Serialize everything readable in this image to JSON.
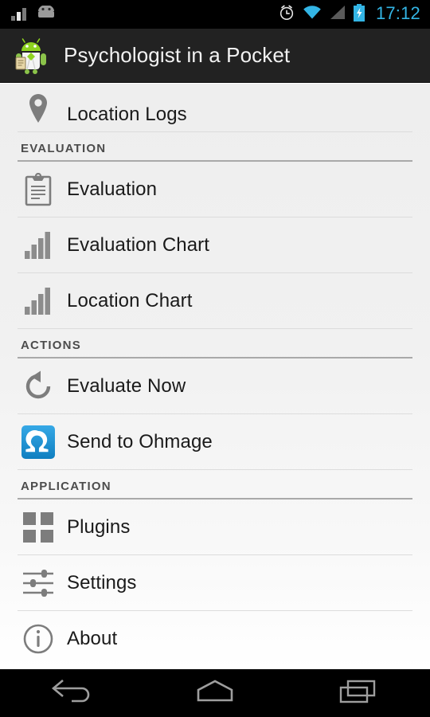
{
  "statusbar": {
    "time": "17:12",
    "icons": [
      "signal-bars-icon",
      "android-head-icon",
      "alarm-clock-icon",
      "wifi-icon",
      "cell-signal-icon",
      "battery-charging-icon"
    ]
  },
  "actionbar": {
    "title": "Psychologist in a Pocket",
    "app_icon": "android-doctor-icon"
  },
  "list": [
    {
      "kind": "item",
      "name": "location-logs",
      "label": "Location Logs",
      "icon": "map-pin-icon"
    },
    {
      "kind": "section",
      "name": "evaluation",
      "label": "EVALUATION"
    },
    {
      "kind": "item",
      "name": "evaluation",
      "label": "Evaluation",
      "icon": "clipboard-icon"
    },
    {
      "kind": "item",
      "name": "evaluation-chart",
      "label": "Evaluation Chart",
      "icon": "bar-chart-icon"
    },
    {
      "kind": "item",
      "name": "location-chart",
      "label": "Location Chart",
      "icon": "bar-chart-icon"
    },
    {
      "kind": "section",
      "name": "actions",
      "label": "ACTIONS"
    },
    {
      "kind": "item",
      "name": "evaluate-now",
      "label": "Evaluate Now",
      "icon": "rotate-ccw-icon"
    },
    {
      "kind": "item",
      "name": "send-to-ohmage",
      "label": "Send to Ohmage",
      "icon": "ohmage-omega-icon"
    },
    {
      "kind": "section",
      "name": "application",
      "label": "APPLICATION"
    },
    {
      "kind": "item",
      "name": "plugins",
      "label": "Plugins",
      "icon": "grid-squares-icon"
    },
    {
      "kind": "item",
      "name": "settings",
      "label": "Settings",
      "icon": "sliders-icon"
    },
    {
      "kind": "item",
      "name": "about",
      "label": "About",
      "icon": "info-circle-icon"
    }
  ],
  "navbar": {
    "back": "back-icon",
    "home": "home-icon",
    "recents": "recent-apps-icon"
  },
  "colors": {
    "status_time": "#33b5e5",
    "action_bar_bg": "#222222",
    "icon_gray": "#7d7d7d",
    "ohmage_blue": "#1e94d2",
    "text_primary": "#1a1a1a",
    "section_text": "#4c4c4c"
  }
}
